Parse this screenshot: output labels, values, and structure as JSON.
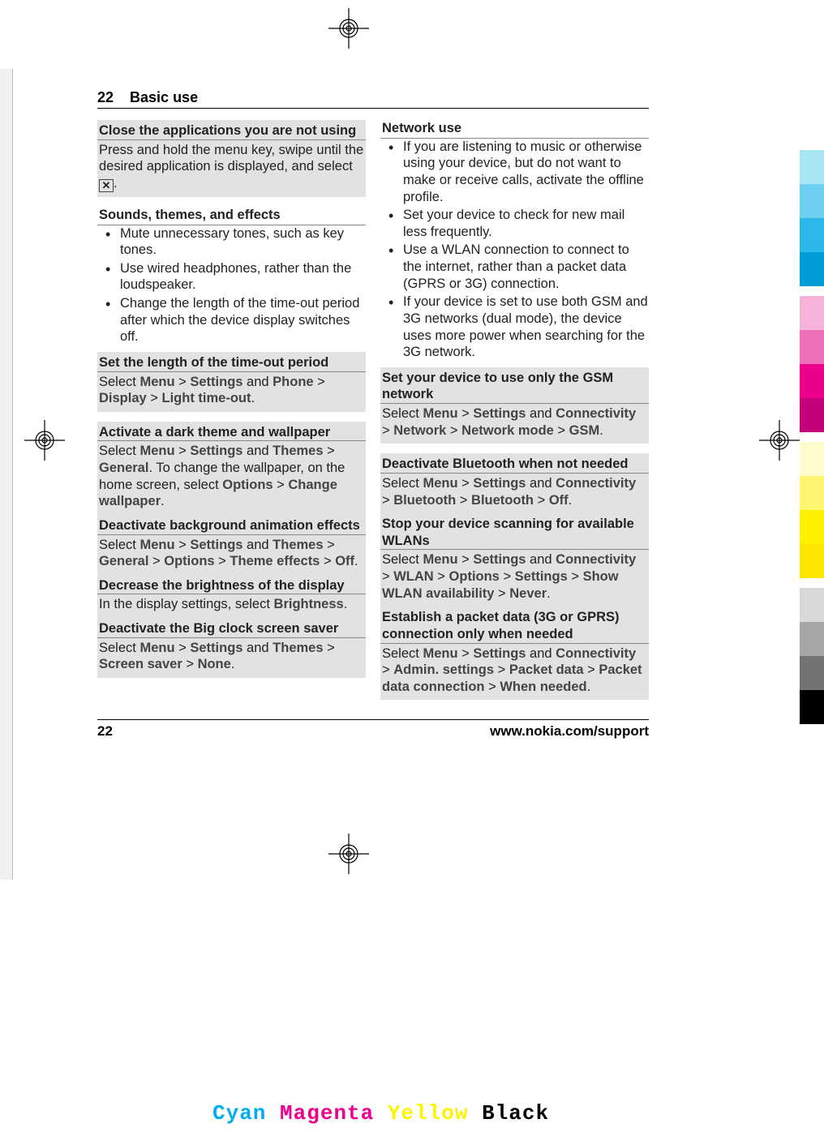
{
  "header": {
    "page_num_top": "22",
    "section": "Basic use"
  },
  "footer": {
    "page_num": "22",
    "url": "www.nokia.com/support"
  },
  "left": {
    "close_apps": {
      "title": "Close the applications you are not using",
      "pre": "Press and hold the menu key, swipe until the desired application is displayed, and select ",
      "post": "."
    },
    "sounds": {
      "title": "Sounds, themes, and effects",
      "items": [
        "Mute unnecessary tones, such as key tones.",
        "Use wired headphones, rather than the loudspeaker.",
        "Change the length of the time-out period after which the device display switches off."
      ]
    },
    "timeout": {
      "title": "Set the length of the time-out period",
      "t1": "Select ",
      "m": "Menu",
      "g1": " > ",
      "s": "Settings",
      "a": " and ",
      "p": "Phone",
      "g2": " > ",
      "d": "Display",
      "g3": " > ",
      "l": "Light time-out",
      "end": "."
    },
    "dark": {
      "title": "Activate a dark theme and wallpaper",
      "t1": "Select ",
      "m": "Menu",
      "g1": " > ",
      "s": "Settings",
      "a": " and ",
      "th": "Themes",
      "g2": " > ",
      "gen": "General",
      "mid": ". To change the wallpaper, on the home screen, select ",
      "opt": "Options",
      "g3": " > ",
      "cw": "Change wallpaper",
      "end": "."
    },
    "anim": {
      "title": "Deactivate background animation effects",
      "t1": "Select ",
      "m": "Menu",
      "g1": " > ",
      "s": "Settings",
      "a": " and ",
      "th": "Themes",
      "g2": " > ",
      "gen": "General",
      "g3": " > ",
      "opt": "Options",
      "g4": " > ",
      "te": "Theme effects",
      "g5": " > ",
      "off": "Off",
      "end": "."
    },
    "bright": {
      "title": "Decrease the brightness of the display",
      "pre": "In the display settings, select ",
      "b": "Brightness",
      "end": "."
    },
    "clock": {
      "title": "Deactivate the Big clock screen saver",
      "t1": "Select ",
      "m": "Menu",
      "g1": " > ",
      "s": "Settings",
      "a": " and ",
      "th": "Themes",
      "g2": " > ",
      "ss": "Screen saver",
      "g3": " > ",
      "none": "None",
      "end": "."
    }
  },
  "right": {
    "network": {
      "title": "Network use",
      "items": [
        "If you are listening to music or otherwise using your device, but do not want to make or receive calls, activate the offline profile.",
        "Set your device to check for new mail less frequently.",
        "Use a WLAN connection to connect to the internet, rather than a packet data (GPRS or 3G) connection.",
        "If your device is set to use both GSM and 3G networks (dual mode), the device uses more power when searching for the 3G network."
      ]
    },
    "gsm": {
      "title": "Set your device to use only the GSM network",
      "t1": "Select ",
      "m": "Menu",
      "g1": " > ",
      "s": "Settings",
      "a": " and ",
      "c": "Connectivity",
      "g2": " > ",
      "n": "Network",
      "g3": " > ",
      "nm": "Network mode",
      "g4": " > ",
      "gsm_v": "GSM",
      "end": "."
    },
    "bt": {
      "title": "Deactivate Bluetooth when not needed",
      "t1": "Select ",
      "m": "Menu",
      "g1": " > ",
      "s": "Settings",
      "a": " and ",
      "c": "Connectivity",
      "g2": " > ",
      "b1": "Bluetooth",
      "g3": " > ",
      "b2": "Bluetooth",
      "g4": " > ",
      "off": "Off",
      "end": "."
    },
    "wlan": {
      "title": "Stop your device scanning for available WLANs",
      "t1": "Select ",
      "m": "Menu",
      "g1": " > ",
      "s": "Settings",
      "a": " and ",
      "c": "Connectivity",
      "g2": " > ",
      "w": "WLAN",
      "g3": " > ",
      "o": "Options",
      "g4": " > ",
      "st": "Settings",
      "g5": " > ",
      "sw": "Show WLAN availability",
      "g6": " > ",
      "nv": "Never",
      "end": "."
    },
    "pd": {
      "title": "Establish a packet data (3G or GPRS) connection only when needed",
      "t1": "Select ",
      "m": "Menu",
      "g1": " > ",
      "s": "Settings",
      "a": " and ",
      "c": "Connectivity",
      "g2": " > ",
      "ad": "Admin. settings",
      "g3": " > ",
      "p1": "Packet data",
      "g4": " > ",
      "p2": "Packet data connection",
      "g5": " > ",
      "wn": "When needed",
      "end": "."
    }
  },
  "cmyb": {
    "c": "Cyan",
    "m": "Magenta",
    "y": "Yellow",
    "k": "Black"
  },
  "colorbars": [
    "#a8e6f5",
    "#6ecff0",
    "#2bb8e8",
    "#009dd9",
    "",
    "#f5b3d9",
    "#ee6fb5",
    "#ec008c",
    "#c4007a",
    "",
    "#fffbcc",
    "#fff570",
    "#fff200",
    "#ffe600",
    "",
    "#d9d9d9",
    "#a6a6a6",
    "#737373",
    "#000000"
  ]
}
